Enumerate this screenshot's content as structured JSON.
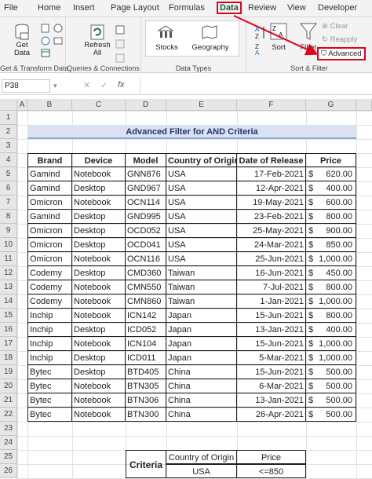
{
  "ribbon_tabs": [
    "File",
    "Home",
    "Insert",
    "Page Layout",
    "Formulas",
    "Data",
    "Review",
    "View",
    "Developer"
  ],
  "active_tab": "Data",
  "ribbon": {
    "get_data": "Get\nData",
    "refresh_all": "Refresh\nAll",
    "stocks": "Stocks",
    "geography": "Geography",
    "sort": "Sort",
    "filter": "Filter",
    "clear": "Clear",
    "reapply": "Reapply",
    "advanced": "Advanced",
    "groups": [
      "Get & Transform Data",
      "Queries & Connections",
      "Data Types",
      "Sort & Filter"
    ]
  },
  "name_box": "P38",
  "fx": "fx",
  "columns": [
    "A",
    "B",
    "C",
    "D",
    "E",
    "F",
    "G"
  ],
  "rows": [
    "1",
    "2",
    "3",
    "4",
    "5",
    "6",
    "7",
    "8",
    "9",
    "10",
    "11",
    "12",
    "13",
    "14",
    "15",
    "16",
    "17",
    "18",
    "19",
    "20",
    "21",
    "22",
    "23",
    "24",
    "25",
    "26"
  ],
  "title": "Advanced Filter for AND Criteria",
  "headers": [
    "Brand",
    "Device",
    "Model",
    "Country of Origin",
    "Date of Release",
    "Price"
  ],
  "data": [
    [
      "Gamind",
      "Notebook",
      "GNN876",
      "USA",
      "17-Feb-2021",
      "620.00"
    ],
    [
      "Gamind",
      "Desktop",
      "GND967",
      "USA",
      "12-Apr-2021",
      "400.00"
    ],
    [
      "Omicron",
      "Notebook",
      "OCN114",
      "USA",
      "19-May-2021",
      "600.00"
    ],
    [
      "Gamind",
      "Desktop",
      "GND995",
      "USA",
      "23-Feb-2021",
      "800.00"
    ],
    [
      "Omicron",
      "Desktop",
      "OCD052",
      "USA",
      "25-May-2021",
      "900.00"
    ],
    [
      "Omicron",
      "Desktop",
      "OCD041",
      "USA",
      "24-Mar-2021",
      "850.00"
    ],
    [
      "Omicron",
      "Notebook",
      "OCN116",
      "USA",
      "25-Jun-2021",
      "1,000.00"
    ],
    [
      "Codemy",
      "Desktop",
      "CMD360",
      "Taiwan",
      "16-Jun-2021",
      "450.00"
    ],
    [
      "Codemy",
      "Notebook",
      "CMN550",
      "Taiwan",
      "7-Jul-2021",
      "800.00"
    ],
    [
      "Codemy",
      "Notebook",
      "CMN860",
      "Taiwan",
      "1-Jan-2021",
      "1,000.00"
    ],
    [
      "Inchip",
      "Notebook",
      "ICN142",
      "Japan",
      "15-Jun-2021",
      "800.00"
    ],
    [
      "Inchip",
      "Desktop",
      "ICD052",
      "Japan",
      "13-Jan-2021",
      "400.00"
    ],
    [
      "Inchip",
      "Notebook",
      "ICN104",
      "Japan",
      "15-Jun-2021",
      "1,000.00"
    ],
    [
      "Inchip",
      "Desktop",
      "ICD011",
      "Japan",
      "5-Mar-2021",
      "1,000.00"
    ],
    [
      "Bytec",
      "Desktop",
      "BTD405",
      "China",
      "15-Jun-2021",
      "500.00"
    ],
    [
      "Bytec",
      "Notebook",
      "BTN305",
      "China",
      "6-Mar-2021",
      "500.00"
    ],
    [
      "Bytec",
      "Notebook",
      "BTN306",
      "China",
      "13-Jan-2021",
      "500.00"
    ],
    [
      "Bytec",
      "Notebook",
      "BTN300",
      "China",
      "26-Apr-2021",
      "500.00"
    ]
  ],
  "currency": "$",
  "criteria": {
    "label": "Criteria",
    "h1": "Country of Origin",
    "h2": "Price",
    "v1": "USA",
    "v2": "<=850"
  },
  "colors": {
    "accent": "#217346",
    "title_bg": "#d9e1f2",
    "red": "#e0001b"
  }
}
